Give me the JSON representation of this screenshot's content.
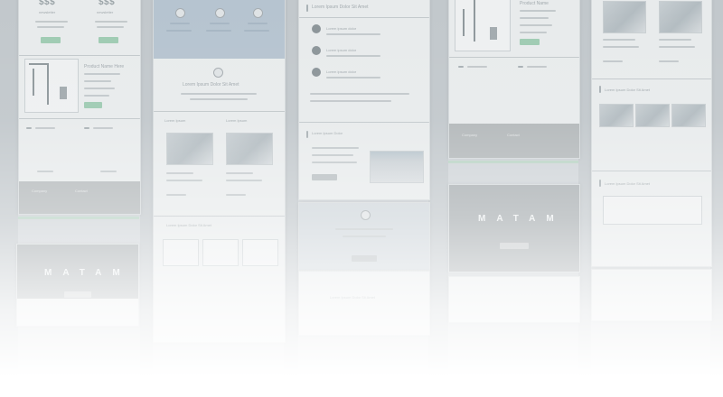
{
  "gallery": {
    "col1": {
      "stat_left": "$$$",
      "stat_right": "$$$",
      "stat_left_label": "newsletter",
      "stat_right_label": "newsletter",
      "product_title": "Product Name Here",
      "banner_logo": "MATAM",
      "footer_left": "Company",
      "footer_right": "Contact"
    },
    "col2": {
      "hero_title": "Lorem Ipsum Dolor Sit Amet",
      "section_left": "Lorem Ipsum",
      "section_right": "Lorem Ipsum",
      "bottom_title": "Lorem Ipsum Dolor Sit Amet"
    },
    "col3": {
      "header_title": "Lorem Ipsum Dolor Sit Amet",
      "steps": [
        "Lorem ipsum dolor",
        "Lorem ipsum dolor",
        "Lorem ipsum dolor"
      ],
      "section_title": "Lorem Ipsum Dolor",
      "cta_label": "Lorem ipsum",
      "bottom_title": "Lorem Ipsum Dolor Sit Amet"
    },
    "col4": {
      "product_title": "Product Name",
      "banner_logo": "MATAM",
      "footer_left": "Company",
      "footer_right": "Contact"
    },
    "col5": {
      "section_title": "Lorem Ipsum Dolor Sit Amet",
      "bottom_title": "Lorem Ipsum Dolor Sit Amet"
    }
  },
  "colors": {
    "accent_green": "#9fcbb3",
    "hero_blue": "#b6c4d0",
    "banner_grey": "#a8aeb1"
  }
}
